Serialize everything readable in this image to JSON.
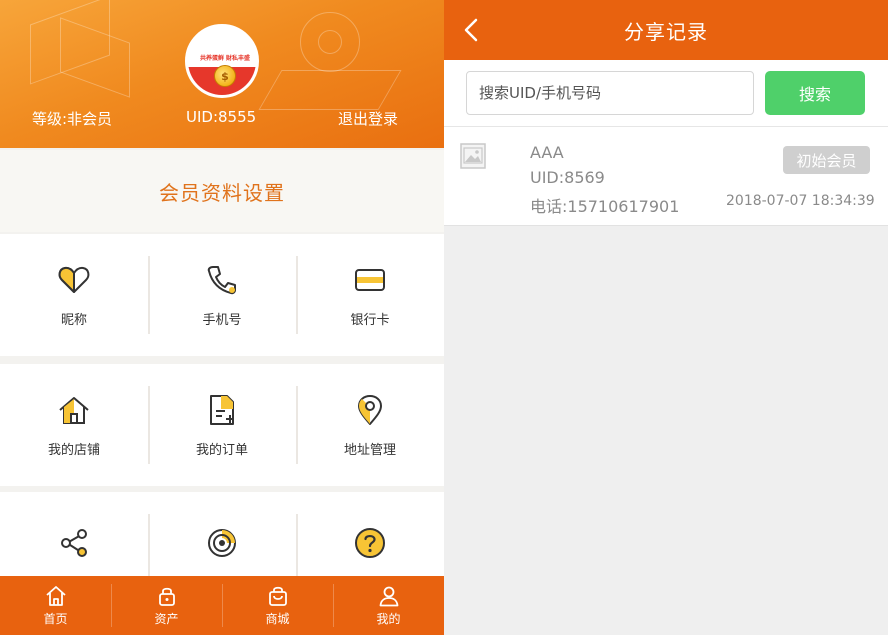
{
  "left": {
    "header": {
      "avatar_slogan": "共养蛋鲜 财私丰盛",
      "avatar_coin_symbol": "$",
      "level": "等级:非会员",
      "uid": "UID:8555",
      "logout": "退出登录"
    },
    "section_title": "会员资料设置",
    "grid": [
      [
        {
          "label": "昵称",
          "icon": "heart-icon"
        },
        {
          "label": "手机号",
          "icon": "phone-icon"
        },
        {
          "label": "银行卡",
          "icon": "bank-card-icon"
        }
      ],
      [
        {
          "label": "我的店铺",
          "icon": "home-icon"
        },
        {
          "label": "我的订单",
          "icon": "order-icon"
        },
        {
          "label": "地址管理",
          "icon": "location-icon"
        }
      ],
      [
        {
          "label": "",
          "icon": "share-icon"
        },
        {
          "label": "",
          "icon": "spiral-icon"
        },
        {
          "label": "",
          "icon": "help-icon"
        }
      ]
    ],
    "tabbar": [
      {
        "label": "首页",
        "icon": "home-tab-icon"
      },
      {
        "label": "资产",
        "icon": "lock-icon"
      },
      {
        "label": "商城",
        "icon": "bag-icon"
      },
      {
        "label": "我的",
        "icon": "user-icon"
      }
    ],
    "colors": {
      "accent": "#e8620f",
      "icon_fill": "#f7c435",
      "icon_stroke": "#333333"
    }
  },
  "right": {
    "nav_title": "分享记录",
    "search": {
      "placeholder": "搜索UID/手机号码",
      "button": "搜索"
    },
    "records": [
      {
        "name": "AAA",
        "uid": "UID:8569",
        "phone": "电话:15710617901",
        "badge": "初始会员",
        "time": "2018-07-07 18:34:39"
      }
    ],
    "colors": {
      "accent": "#e8620f",
      "search_button": "#4fd06a",
      "badge": "#cfcfcf"
    }
  }
}
